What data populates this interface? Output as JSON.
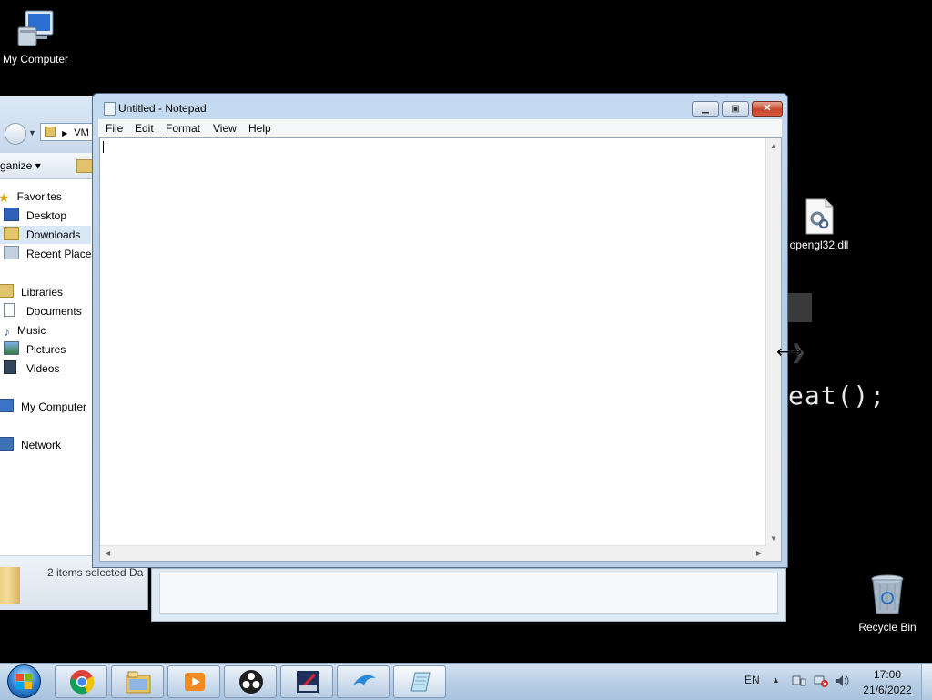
{
  "desktop": {
    "icons": [
      {
        "label": "My Computer"
      },
      {
        "label": "opengl32.dll"
      },
      {
        "label": "Recycle Bin"
      }
    ],
    "background_code_fragment": "eat();"
  },
  "explorer": {
    "address_text": "VM",
    "toolbar_organize": "rganize ▾",
    "nav": {
      "favorites": "Favorites",
      "desktop": "Desktop",
      "downloads": "Downloads",
      "recent": "Recent Places",
      "libraries": "Libraries",
      "documents": "Documents",
      "music": "Music",
      "pictures": "Pictures",
      "videos": "Videos",
      "computer": "My Computer",
      "network": "Network"
    },
    "status": "2 items selected  Da"
  },
  "notepad": {
    "title": "Untitled - Notepad",
    "menu": [
      "File",
      "Edit",
      "Format",
      "View",
      "Help"
    ],
    "content": ""
  },
  "taskbar": {
    "language": "EN",
    "time": "17:00",
    "date": "21/6/2022",
    "pinned": [
      "chrome-icon",
      "explorer-icon",
      "media-player-icon",
      "obs-icon",
      "editor-icon",
      "dolphin-icon",
      "notepad-icon"
    ]
  },
  "colors": {
    "desktop_bg": "#000000",
    "window_frame": "#b9d0e8",
    "close_button": "#c8462c",
    "taskbar": "#b9cfe6"
  }
}
